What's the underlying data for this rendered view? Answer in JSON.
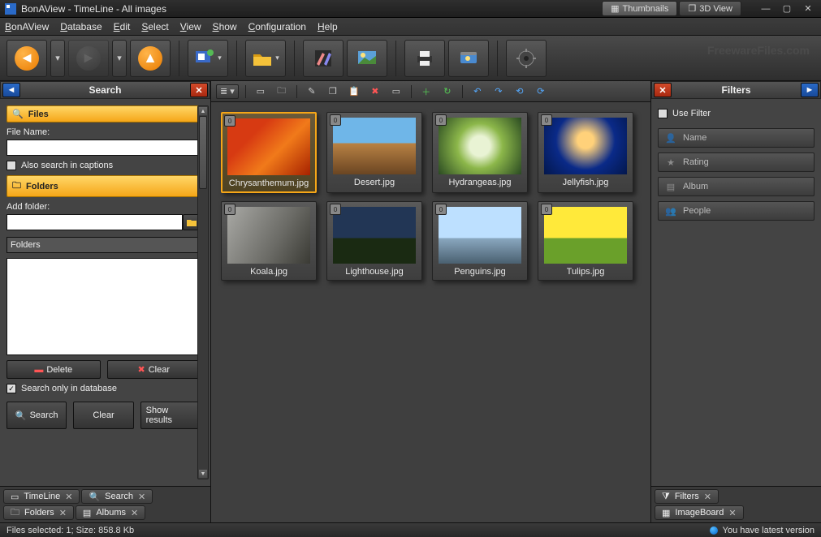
{
  "titlebar": {
    "title": "BonAView - TimeLine - All images",
    "view_tabs": [
      {
        "label": "Thumbnails",
        "active": true
      },
      {
        "label": "3D View",
        "active": false
      }
    ]
  },
  "menubar": [
    "BonAView",
    "Database",
    "Edit",
    "Select",
    "View",
    "Show",
    "Configuration",
    "Help"
  ],
  "watermark": "FreewareFiles.com",
  "left_panel": {
    "title": "Search",
    "files_header": "Files",
    "file_name_label": "File Name:",
    "file_name_value": "",
    "also_captions_label": "Also search in captions",
    "folders_header": "Folders",
    "add_folder_label": "Add folder:",
    "add_folder_value": "",
    "folders_placeholder": "Folders",
    "delete_btn": "Delete",
    "clear_btn": "Clear",
    "search_db_label": "Search only in database",
    "search_btn": "Search",
    "clear2_btn": "Clear",
    "show_results_btn": "Show results",
    "tabs_row1": [
      {
        "label": "TimeLine",
        "closable": true
      },
      {
        "label": "Search",
        "closable": true
      }
    ],
    "tabs_row2": [
      {
        "label": "Folders",
        "closable": true
      },
      {
        "label": "Albums",
        "closable": true
      }
    ]
  },
  "thumbnails": [
    {
      "label": "Chrysanthemum.jpg",
      "selected": true,
      "bg": "linear-gradient(135deg,#d73a12 30%,#f17a1a 60%,#a62100)"
    },
    {
      "label": "Desert.jpg",
      "selected": false,
      "bg": "linear-gradient(#6fb6e8 45%,#b98244 45%,#6a4522)"
    },
    {
      "label": "Hydrangeas.jpg",
      "selected": false,
      "bg": "radial-gradient(circle at 50% 50%,#e9f3d4 20%,#8cb74a 45%,#2a4a22)"
    },
    {
      "label": "Jellyfish.jpg",
      "selected": false,
      "bg": "radial-gradient(circle at 50% 40%,#ffd17a 15%,#0a2a88 55%,#03174c)"
    },
    {
      "label": "Koala.jpg",
      "selected": false,
      "bg": "linear-gradient(120deg,#a9a9a5,#6b6b66 60%,#3a3a34)"
    },
    {
      "label": "Lighthouse.jpg",
      "selected": false,
      "bg": "linear-gradient(#223655 55%,#1a2a12 55%)"
    },
    {
      "label": "Penguins.jpg",
      "selected": false,
      "bg": "linear-gradient(#bde0ff 55%,#8aa8c0 55%,#4a6070)"
    },
    {
      "label": "Tulips.jpg",
      "selected": false,
      "bg": "linear-gradient(#ffe93a 55%,#6aa02a 55%)"
    }
  ],
  "right_panel": {
    "title": "Filters",
    "use_filter_label": "Use Filter",
    "rows": [
      "Name",
      "Rating",
      "Album",
      "People"
    ],
    "tabs": [
      {
        "label": "Filters",
        "closable": true
      },
      {
        "label": "ImageBoard",
        "closable": true
      }
    ]
  },
  "statusbar": {
    "left": "Files selected: 1; Size: 858.8 Kb",
    "right": "You have latest version"
  }
}
